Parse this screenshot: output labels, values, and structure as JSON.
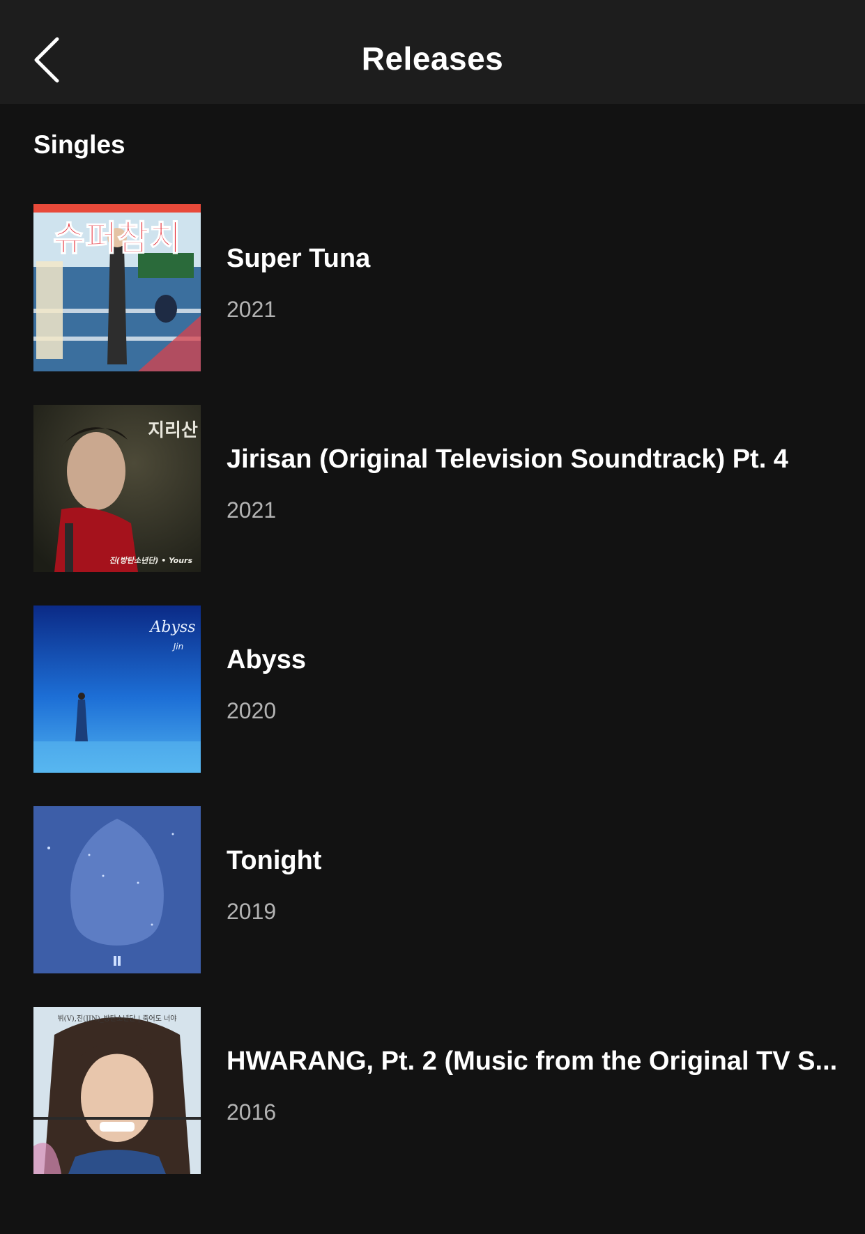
{
  "header": {
    "title": "Releases",
    "back_icon": "chevron-left-icon"
  },
  "section": {
    "title": "Singles"
  },
  "releases": [
    {
      "title": "Super Tuna",
      "year": "2021",
      "cover_lettering": "슈퍼참치"
    },
    {
      "title": "Jirisan (Original Television Soundtrack) Pt. 4",
      "year": "2021",
      "cover_lettering": "지리산",
      "cover_caption": "진(방탄소년단) • Yours"
    },
    {
      "title": "Abyss",
      "year": "2020",
      "cover_lettering": "Abyss",
      "cover_caption": "Jin"
    },
    {
      "title": "Tonight",
      "year": "2019"
    },
    {
      "title": "HWARANG, Pt. 2 (Music from the Original TV S...",
      "year": "2016",
      "cover_caption": "뷔(V),진(JIN)_방탄소년단 | 죽어도 너야"
    }
  ],
  "colors": {
    "background": "#121212",
    "header_background": "#1d1d1d",
    "text_primary": "#ffffff",
    "text_secondary": "#b3b3b3"
  }
}
